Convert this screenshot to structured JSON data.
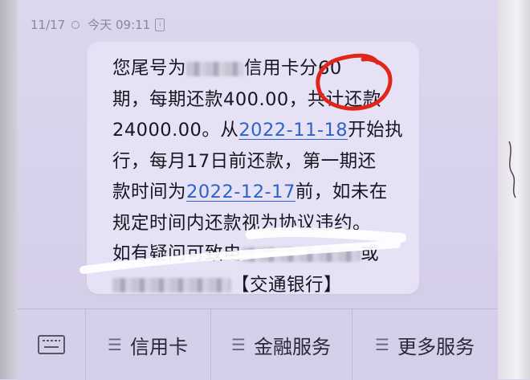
{
  "status": {
    "date": "11/17",
    "time": "今天 09:11",
    "info_glyph": "i"
  },
  "message": {
    "line1_prefix": "您尾号为",
    "line1_suffix": "信用卡分60",
    "line2": "期，每期还款400.00，共计还款",
    "line3_prefix": "24000.00。从",
    "line3_link": "2022-11-18",
    "line3_suffix": "开始执",
    "line4": "行，每月17日前还款，第一期还",
    "line5_prefix": "款时间为",
    "line5_link": "2022-12-17",
    "line5_suffix": "前，如未在",
    "line6": "规定时间内还款视为协议违约。",
    "line7_prefix": "如有疑问可致电",
    "line7_suffix": "或",
    "line8_suffix": "【交通银行】"
  },
  "bottom_menu": [
    {
      "label": "信用卡",
      "icon": "menu-lines-icon"
    },
    {
      "label": "金融服务",
      "icon": "menu-lines-icon"
    },
    {
      "label": "更多服务",
      "icon": "menu-lines-icon"
    }
  ],
  "colors": {
    "link": "#2c63c8",
    "annotation_circle": "#e0251b",
    "background": "#d9d3ec"
  }
}
